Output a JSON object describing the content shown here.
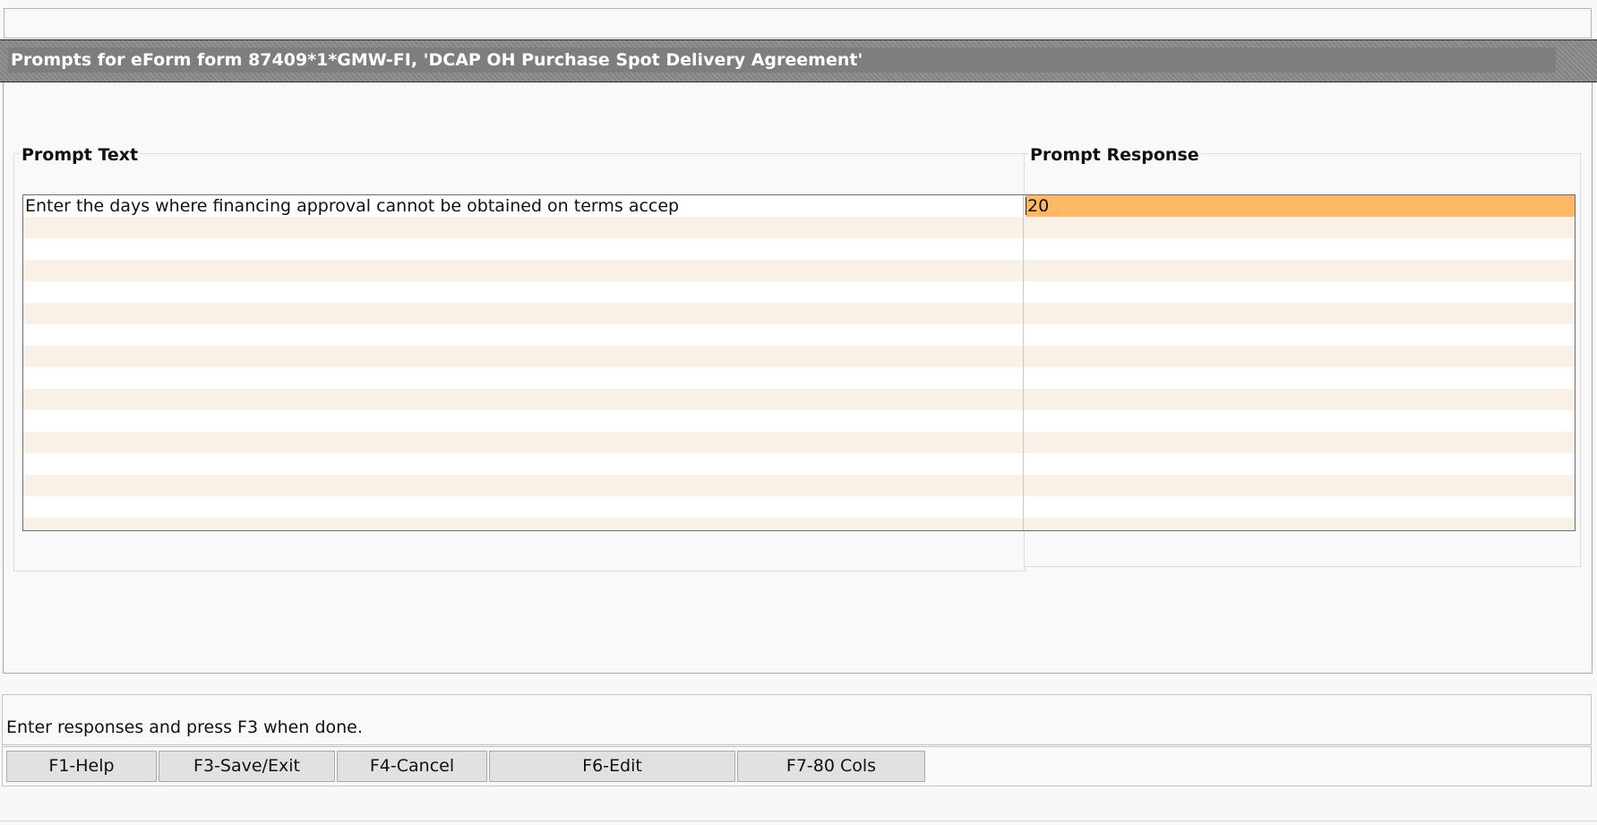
{
  "window": {
    "title": "Prompts for eForm form 87409*1*GMW-FI, 'DCAP OH Purchase Spot Delivery Agreement'"
  },
  "columns": {
    "prompt_text_header": "Prompt Text",
    "prompt_response_header": "Prompt Response"
  },
  "prompts": [
    {
      "text": "Enter the days where financing approval cannot be obtained on terms accep",
      "response": "20"
    }
  ],
  "status": {
    "message": "Enter responses and press F3 when done."
  },
  "function_keys": [
    {
      "label": "F1-Help"
    },
    {
      "label": "F3-Save/Exit"
    },
    {
      "label": "F4-Cancel"
    },
    {
      "label": "F6-Edit"
    },
    {
      "label": "F7-80 Cols"
    }
  ],
  "colors": {
    "active_response": "#ffb866",
    "row_alt": "#f9f1e5",
    "title_band": "#8a8a8a"
  }
}
